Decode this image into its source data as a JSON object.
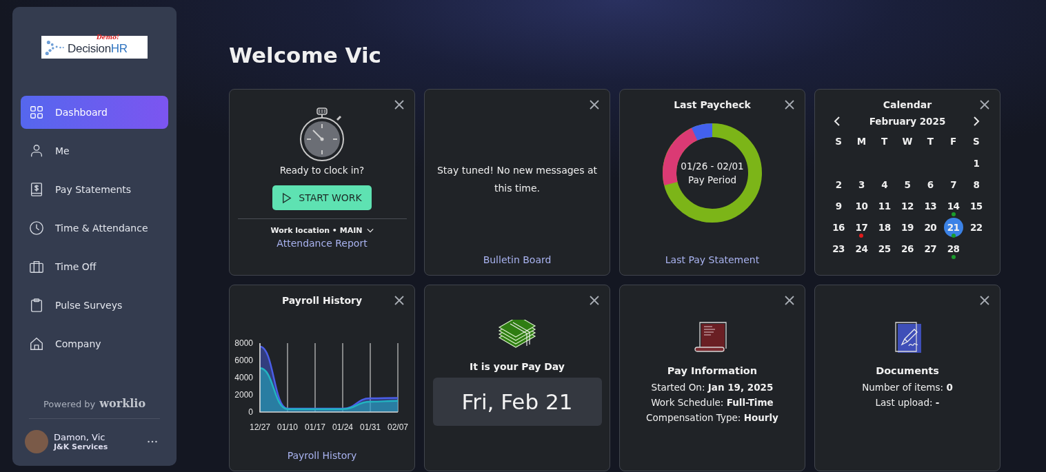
{
  "sidebar": {
    "logo": {
      "tag": "Demo!",
      "name": "Decision",
      "suffix": "HR"
    },
    "items": [
      {
        "label": "Dashboard",
        "selected": true
      },
      {
        "label": "Me",
        "selected": false
      },
      {
        "label": "Pay Statements",
        "selected": false
      },
      {
        "label": "Time & Attendance",
        "selected": false
      },
      {
        "label": "Time Off",
        "selected": false
      },
      {
        "label": "Pulse Surveys",
        "selected": false
      },
      {
        "label": "Company",
        "selected": false
      }
    ],
    "powered_by": "Powered by",
    "brand": "worklio",
    "user": {
      "name": "Damon, Vic",
      "company": "J&K Services"
    }
  },
  "heading": "Welcome Vic",
  "cards": [
    {
      "kind": "clock",
      "prompt": "Ready to clock in?",
      "button": "START WORK",
      "location": "Work location • MAIN",
      "link": "Attendance Report"
    },
    {
      "kind": "bulletin",
      "message": "Stay tuned! No new messages at this time.",
      "link": "Bulletin Board"
    },
    {
      "kind": "paycheck",
      "title": "Last Paycheck",
      "period": "01/26 - 02/01",
      "period_label": "Pay Period",
      "link": "Last Pay Statement"
    },
    {
      "kind": "calendar",
      "title": "Calendar",
      "month": "February 2025",
      "weekdays": [
        "S",
        "M",
        "T",
        "W",
        "T",
        "F",
        "S"
      ],
      "weeks": [
        [
          {
            "day": "1",
            "selected": false
          }
        ],
        [
          {
            "day": "2",
            "selected": false
          },
          {
            "day": "3",
            "selected": false
          },
          {
            "day": "4",
            "selected": false
          },
          {
            "day": "5",
            "selected": false
          },
          {
            "day": "6",
            "selected": false
          },
          {
            "day": "7",
            "selected": false
          },
          {
            "day": "8",
            "selected": false
          }
        ],
        [
          {
            "day": "9",
            "selected": false
          },
          {
            "day": "10",
            "selected": false
          },
          {
            "day": "11",
            "selected": false
          },
          {
            "day": "12",
            "selected": false
          },
          {
            "day": "13",
            "selected": false
          },
          {
            "day": "14",
            "selected": false,
            "color": "#1a9c2c"
          },
          {
            "day": "15",
            "selected": false
          }
        ],
        [
          {
            "day": "16",
            "selected": false
          },
          {
            "day": "17",
            "selected": false,
            "color": "#e01b1b"
          },
          {
            "day": "18",
            "selected": false
          },
          {
            "day": "19",
            "selected": false
          },
          {
            "day": "20",
            "selected": false
          },
          {
            "day": "21",
            "selected": true,
            "color": "#1a9c2c"
          },
          {
            "day": "22",
            "selected": false
          }
        ],
        [
          {
            "day": "23",
            "selected": false
          },
          {
            "day": "24",
            "selected": false
          },
          {
            "day": "25",
            "selected": false
          },
          {
            "day": "26",
            "selected": false
          },
          {
            "day": "27",
            "selected": false
          },
          {
            "day": "28",
            "selected": false,
            "color": "#1a9c2c"
          }
        ]
      ]
    },
    {
      "kind": "payroll",
      "title": "Payroll History",
      "link": "Payroll History",
      "chart_data": {
        "type": "area",
        "grid": true,
        "categories": [
          "12/27",
          "01/10",
          "01/17",
          "01/24",
          "01/31",
          "02/07"
        ],
        "ylim": [
          0,
          8000
        ],
        "yticks": [
          0,
          2000,
          4000,
          6000,
          8000
        ],
        "series": [
          {
            "color": "#4a5ee8",
            "values": [
              7600,
              400,
              400,
              400,
              1600,
              1650
            ]
          },
          {
            "color": "#22b3c0",
            "values": [
              5100,
              350,
              350,
              350,
              1200,
              1300
            ]
          }
        ]
      }
    },
    {
      "kind": "payday",
      "text": "It is your Pay Day",
      "date": "Fri, Feb 21"
    },
    {
      "kind": "info",
      "title": "Pay Information",
      "lines": [
        "Started On: **Jan 19, 2025**",
        "Work Schedule: **Full-Time**",
        "Compensation Type: **Hourly**"
      ]
    },
    {
      "kind": "documents",
      "title": "Documents",
      "lines": [
        "Number of items: **0**",
        "Last upload: **-**"
      ]
    }
  ]
}
